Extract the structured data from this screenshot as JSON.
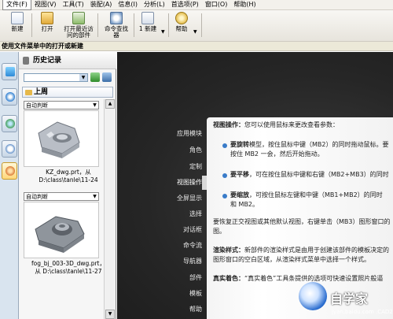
{
  "menubar": {
    "items": [
      "文件(F)",
      "视图(V)",
      "工具(T)",
      "装配(A)",
      "信息(I)",
      "分析(L)",
      "首选项(P)",
      "窗口(O)",
      "帮助(H)"
    ]
  },
  "toolbar": {
    "buttons": [
      {
        "label": "新建",
        "icon": "new-file-icon"
      },
      {
        "label": "打开",
        "icon": "open-folder-icon"
      },
      {
        "label": "打开最近访\n问的部件",
        "icon": "open-recent-icon"
      },
      {
        "label": "命令查找\n器",
        "icon": "command-finder-icon"
      },
      {
        "label": "1 新建",
        "icon": "new-window-icon"
      },
      {
        "label": "帮助",
        "icon": "help-icon"
      }
    ]
  },
  "cueline": {
    "text": "使用文件菜单中的打开或新建"
  },
  "history": {
    "title": "历史记录",
    "group": "上周",
    "items": [
      {
        "select": "自动判断",
        "name": "KZ_dwg.prt，从",
        "path": "D:\\class\\tanle\\11-24"
      },
      {
        "select": "自动判断",
        "name": "fog_bj_003-3D_dwg.prt，",
        "path": "从 D:\\class\\tanle\\11-27"
      }
    ]
  },
  "nav": {
    "items": [
      "应用模块",
      "角色",
      "定制",
      "视图操作",
      "全屏显示",
      "选择",
      "对话框",
      "命令流",
      "导航器",
      "部件",
      "模板",
      "帮助"
    ],
    "active_index": 3
  },
  "content": {
    "heading": "视图操作：",
    "heading_rest": "您可以使用鼠标来更改查看参数：",
    "b1_bold": "要旋转",
    "b1_rest": "模型，按住鼠标中键（MB2）的同时拖动鼠标。要",
    "b1_line2": "按住 MB2 一会，然后开始拖动。",
    "b2_bold": "要平移",
    "b2_rest": "，可在按住鼠标中键和右键（MB2+MB3）的同时",
    "b3_bold": "要缩放",
    "b3_rest": "，可按住鼠标左键和中键（MB1+MB2）的同时",
    "b3_line2": "和 MB2。",
    "p2_line1": "要恢复正交视图或其他默认视图，右键单击（MB3）图形窗口的",
    "p2_line2": "图。",
    "p3_bold": "渲染样式：",
    "p3_rest": "新部件的渲染样式是由用于创建该部件的模板决定的",
    "p3_line2": "图形窗口的空白区域，从渲染样式菜单中选择一个样式。",
    "p4_bold": "真实着色：",
    "p4_rest": "“真实着色”工具条提供的选项可快速设置照片般逼"
  },
  "watermark": {
    "big": "自学家",
    "url": "jyan.baidu.com  .CAD21.com"
  },
  "colors": {
    "main_bg": "#262626",
    "accent_blue": "#3a7cc9"
  }
}
